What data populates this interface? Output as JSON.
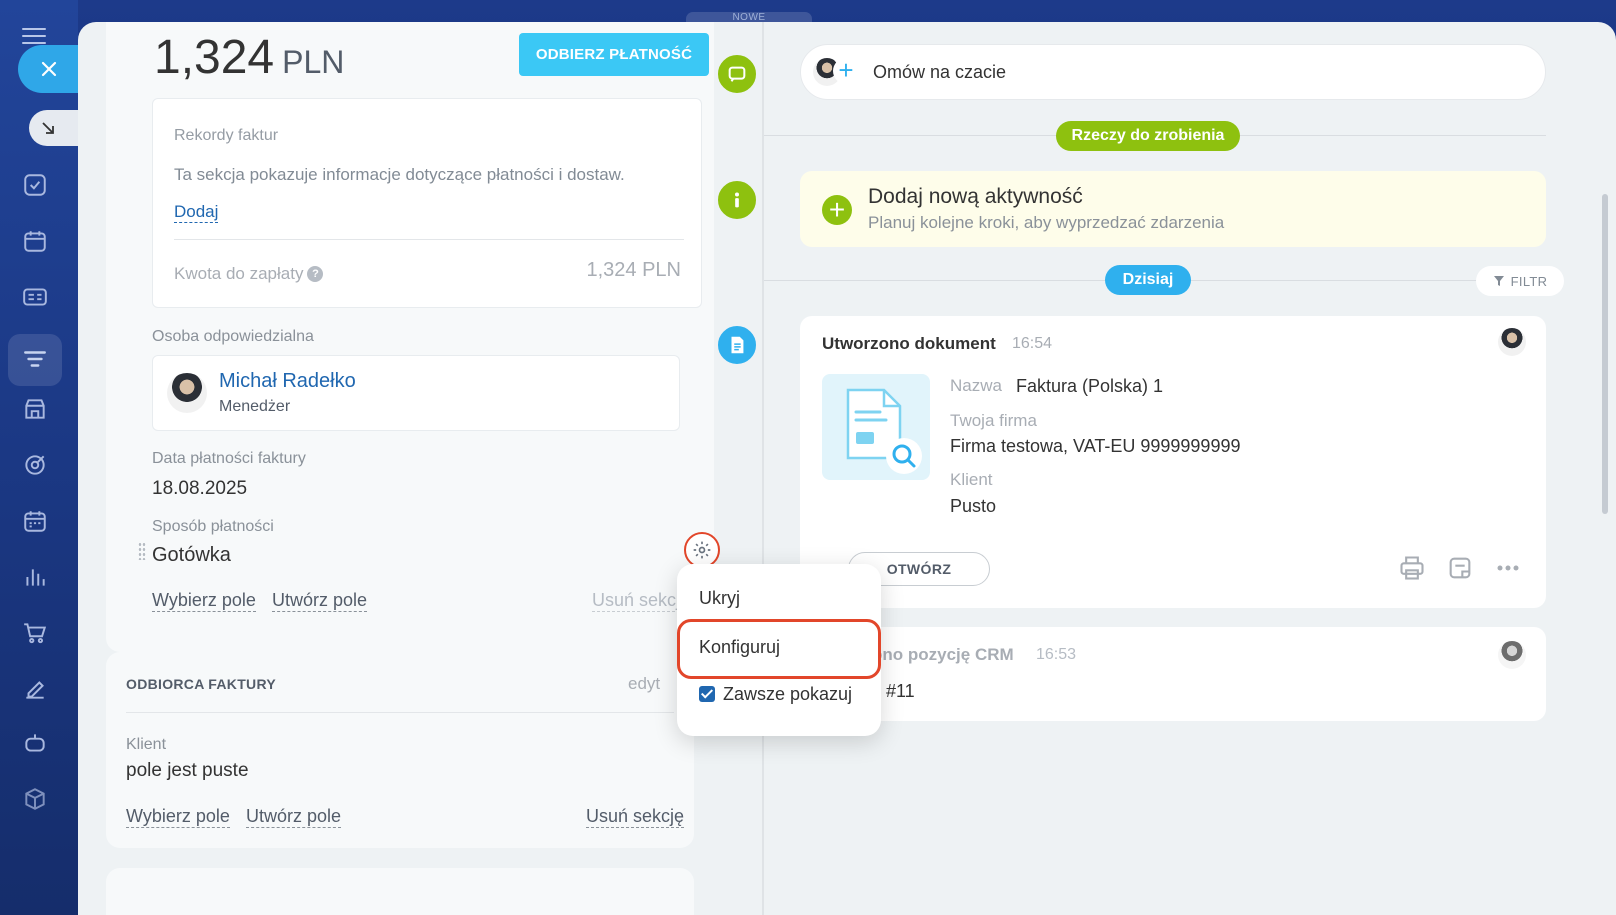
{
  "sidebar": {
    "icons": [
      "menu-icon",
      "close-icon",
      "collapse-icon",
      "tasks-icon",
      "calendar-icon",
      "contact-card-icon",
      "crm-funnel-icon",
      "store-icon",
      "target-icon",
      "schedule-icon",
      "analytics-icon",
      "cart-icon",
      "sign-icon",
      "robot-icon",
      "box-icon"
    ],
    "top_label": "NOWE"
  },
  "deal": {
    "amount": "1,324",
    "currency": "PLN",
    "pay_button": "ODBIERZ PŁATNOŚĆ"
  },
  "invoice_records": {
    "title": "Rekordy faktur",
    "description": "Ta sekcja pokazuje informacje dotyczące płatności i dostaw.",
    "add_link": "Dodaj",
    "due_label": "Kwota do zapłaty",
    "due_value": "1,324 PLN"
  },
  "responsible": {
    "label": "Osoba odpowiedzialna",
    "name": "Michał Radełko",
    "role": "Menedżer"
  },
  "payment_date": {
    "label": "Data płatności faktury",
    "value": "18.08.2025"
  },
  "payment_method": {
    "label": "Sposób płatności",
    "value": "Gotówka"
  },
  "section_actions": {
    "select_field": "Wybierz pole",
    "create_field": "Utwórz pole",
    "delete_section": "Usuń sekcję"
  },
  "recipient": {
    "title": "ODBIORCA FAKTURY",
    "edit": "edyt",
    "client_label": "Klient",
    "client_value": "pole jest puste",
    "select_field": "Wybierz pole",
    "create_field": "Utwórz pole",
    "delete_section": "Usuń sekcję"
  },
  "popup": {
    "hide": "Ukryj",
    "configure": "Konfiguruj",
    "always_show": "Zawsze pokazuj",
    "always_show_checked": true
  },
  "timeline": {
    "chat_placeholder": "Omów na czacie",
    "todo_pill": "Rzeczy do zrobienia",
    "add_activity_title": "Dodaj nową aktywność",
    "add_activity_sub": "Planuj kolejne kroki, aby wyprzedzać zdarzenia",
    "today_pill": "Dzisiaj",
    "filter": "FILTR",
    "doc_event": {
      "title": "Utworzono dokument",
      "time": "16:54",
      "name_label": "Nazwa",
      "name_value": "Faktura (Polska) 1",
      "company_label": "Twoja firma",
      "company_value": "Firma testowa, VAT-EU 9999999999",
      "client_label": "Klient",
      "client_value": "Pusto",
      "open_button": "OTWÓRZ"
    },
    "crm_event": {
      "title": "ono pozycję CRM",
      "time": "16:53",
      "number": "#11"
    }
  },
  "colors": {
    "accent_blue": "#3bc8f5",
    "green": "#8ec10f",
    "highlight_red": "#e2462a",
    "link_blue": "#2067b0"
  }
}
